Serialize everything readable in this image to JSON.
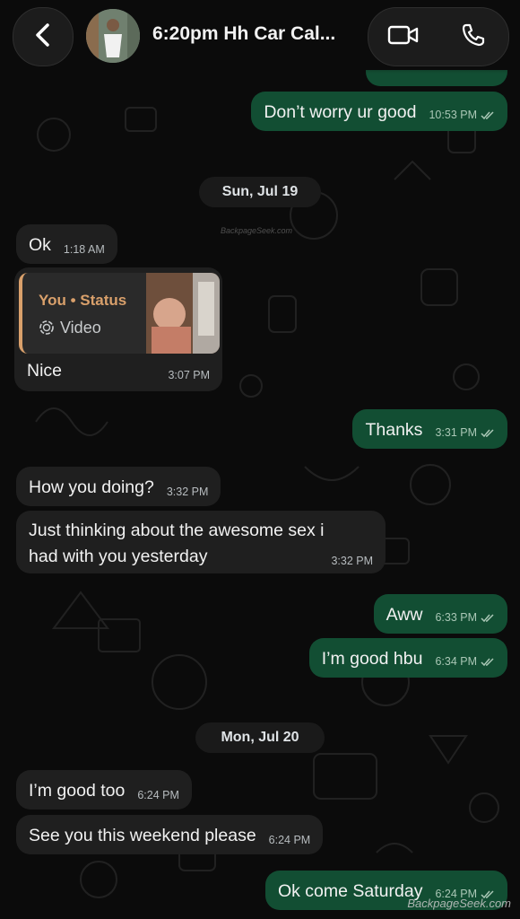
{
  "header": {
    "back_icon": "chevron-left-icon",
    "title": "6:20pm Hh Car Cal...",
    "video_icon": "video-camera-icon",
    "phone_icon": "phone-icon"
  },
  "colors": {
    "incoming_bubble": "#1f1f1f",
    "outgoing_bubble": "#124e33",
    "status_accent": "#d9a06b",
    "background": "#0b0b0b"
  },
  "messages": [
    {
      "dir": "out",
      "text": "Don’t worry ur good",
      "time": "10:53 PM",
      "read": true
    },
    {
      "type": "date",
      "text": "Sun, Jul 19"
    },
    {
      "dir": "in",
      "text": "Ok",
      "time": "1:18 AM"
    },
    {
      "dir": "in",
      "reply": {
        "author": "You • Status",
        "kind": "Video",
        "kind_icon": "status-ring-icon"
      },
      "text": "Nice",
      "time": "3:07 PM"
    },
    {
      "dir": "out",
      "text": "Thanks",
      "time": "3:31 PM",
      "read": true
    },
    {
      "dir": "in",
      "text": "How you doing?",
      "time": "3:32 PM"
    },
    {
      "dir": "in",
      "text_lines": [
        "Just thinking about the awesome sex i",
        "had with you yesterday"
      ],
      "time": "3:32 PM"
    },
    {
      "dir": "out",
      "text": "Aww",
      "time": "6:33 PM",
      "read": true
    },
    {
      "dir": "out",
      "text": "I’m good hbu",
      "time": "6:34 PM",
      "read": true
    },
    {
      "type": "date",
      "text": "Mon, Jul 20"
    },
    {
      "dir": "in",
      "text": "I’m good too",
      "time": "6:24 PM"
    },
    {
      "dir": "in",
      "text": "See you this weekend please",
      "time": "6:24 PM"
    },
    {
      "dir": "out",
      "text": "Ok come Saturday",
      "time": "6:24 PM",
      "read": true
    }
  ],
  "watermarks": [
    "BackpageSeek.com",
    "BackpageSeek.com"
  ]
}
